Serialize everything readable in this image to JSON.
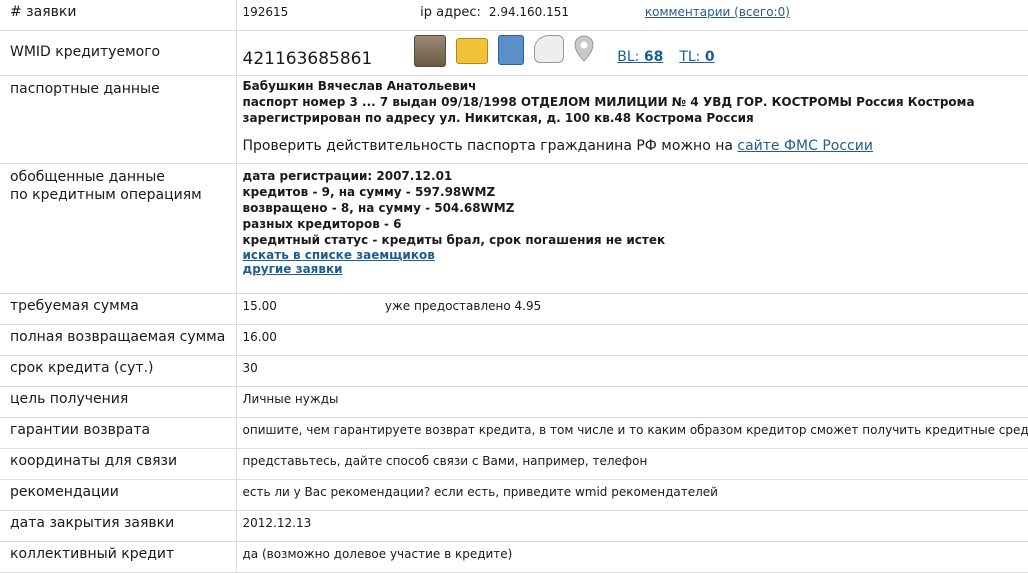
{
  "rows": {
    "number": {
      "label": "# заявки",
      "value": "192615",
      "ip_label": "ip адрес:",
      "ip_value": "2.94.160.151",
      "comments_link": "комментарии (всего:0)"
    },
    "wmid": {
      "label": "WMID кредитуемого",
      "value": "421163685861",
      "bl_label": "BL:",
      "bl_value": "68",
      "tl_label": "TL:",
      "tl_value": "0",
      "icons": [
        "photo-portrait-icon",
        "id-card-icon",
        "passport-icon",
        "certificate-icon",
        "location-pin-icon"
      ]
    },
    "passport": {
      "label": "паспортные данные",
      "name": "Бабушкин Вячеслав Анатольевич",
      "line2": "паспорт номер 3 ... 7 выдан 09/18/1998 ОТДЕЛОМ МИЛИЦИИ № 4 УВД ГОР. КОСТРОМЫ Россия Кострома",
      "line3": "зарегистрирован по адресу ул. Никитская, д. 100 кв.48 Кострома Россия",
      "check_text": "Проверить действительность паспорта гражданина РФ можно на",
      "check_link": "сайте ФМС России"
    },
    "credit": {
      "label_line1": "обобщенные данные",
      "label_line2": "по кредитным операциям",
      "reg_date": "дата регистрации: 2007.12.01",
      "credits": "кредитов - 9, на сумму - 597.98WMZ",
      "returned": "возвращено - 8, на сумму - 504.68WMZ",
      "creditors": "разных кредиторов - 6",
      "status": "кредитный статус - кредиты брал, срок погашения не истек",
      "link_search": "искать в списке заемщиков",
      "link_other": "другие заявки"
    },
    "amount": {
      "label": "требуемая сумма",
      "value": "15.00",
      "already_label": "уже предоставлено",
      "already_value": "4.95"
    },
    "return_amount": {
      "label": "полная возвращаемая сумма",
      "value": "16.00"
    },
    "term": {
      "label": "срок кредита (сут.)",
      "value": "30"
    },
    "purpose": {
      "label": "цель получения",
      "value": "Личные нужды"
    },
    "guarantee": {
      "label": "гарантии возврата",
      "value": "опишите, чем гарантируете возврат кредита, в том числе и то каким образом кредитор сможет получить кредитные средства"
    },
    "contacts": {
      "label": "координаты для связи",
      "value": "представьтесь, дайте способ связи с Вами, например, телефон"
    },
    "recommend": {
      "label": "рекомендации",
      "value": "есть ли у Вас рекомендации? если есть, приведите wmid рекомендателей"
    },
    "close_date": {
      "label": "дата закрытия заявки",
      "value": "2012.12.13"
    },
    "collective": {
      "label": "коллективный кредит",
      "value": "да (возможно долевое участие в кредите)"
    }
  }
}
